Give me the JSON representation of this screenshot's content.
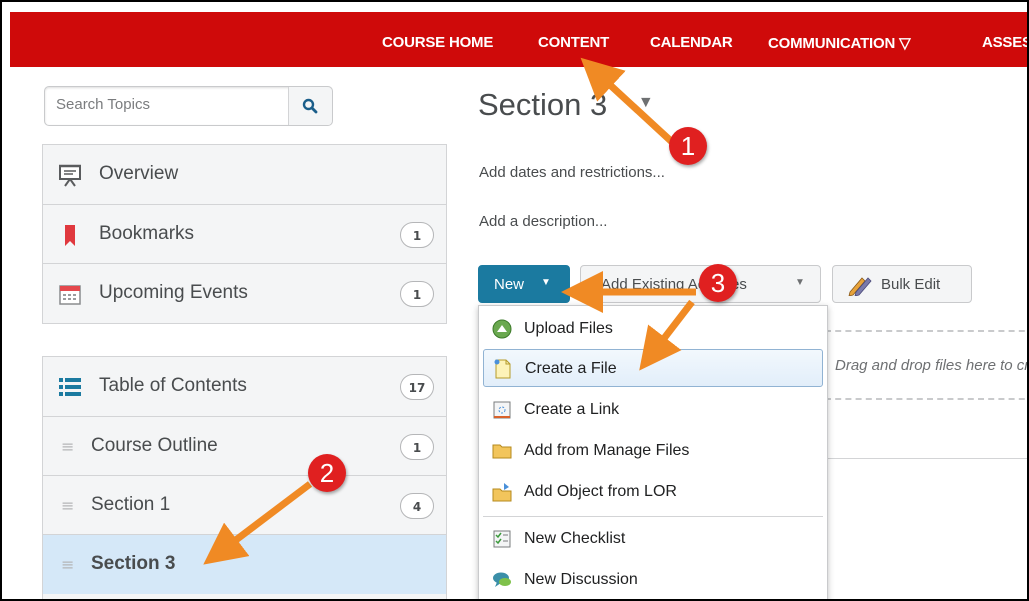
{
  "nav": {
    "items": [
      "COURSE HOME",
      "CONTENT",
      "CALENDAR",
      "COMMUNICATION ▽",
      "ASSES"
    ]
  },
  "search": {
    "placeholder": "Search Topics",
    "icon": "search-icon"
  },
  "sidebar": {
    "top_items": [
      {
        "label": "Overview",
        "icon": "presentation-icon",
        "badge": ""
      },
      {
        "label": "Bookmarks",
        "icon": "bookmark-icon",
        "badge": "1"
      },
      {
        "label": "Upcoming Events",
        "icon": "calendar-icon",
        "badge": "1"
      }
    ],
    "toc": {
      "label": "Table of Contents",
      "icon": "list-icon",
      "badge": "17"
    },
    "modules": [
      {
        "label": "Course Outline",
        "badge": "1"
      },
      {
        "label": "Section 1",
        "badge": "4"
      },
      {
        "label": "Section 3",
        "badge": ""
      }
    ]
  },
  "main": {
    "title": "Section 3",
    "dates_link": "Add dates and restrictions...",
    "description_link": "Add a description...",
    "new_button": "New",
    "existing_button": "Add Existing Activities",
    "bulk_edit_button": "Bulk Edit",
    "dropzone_text": "Drag and drop files here to cre"
  },
  "dropdown": {
    "items": [
      {
        "label": "Upload Files",
        "icon": "upload-icon"
      },
      {
        "label": "Create a File",
        "icon": "new-file-icon"
      },
      {
        "label": "Create a Link",
        "icon": "link-icon"
      },
      {
        "label": "Add from Manage Files",
        "icon": "folder-icon"
      },
      {
        "label": "Add Object from LOR",
        "icon": "lor-icon"
      },
      {
        "label": "New Checklist",
        "icon": "checklist-icon"
      },
      {
        "label": "New Discussion",
        "icon": "discussion-icon"
      }
    ]
  },
  "annotations": {
    "step1": "1",
    "step2": "2",
    "step3": "3"
  },
  "colors": {
    "topbar": "#cf0a0a",
    "primary": "#1b7aa0",
    "selected_row": "#d5e8f8",
    "arrow": "#f08a24",
    "marker": "#e02020"
  }
}
